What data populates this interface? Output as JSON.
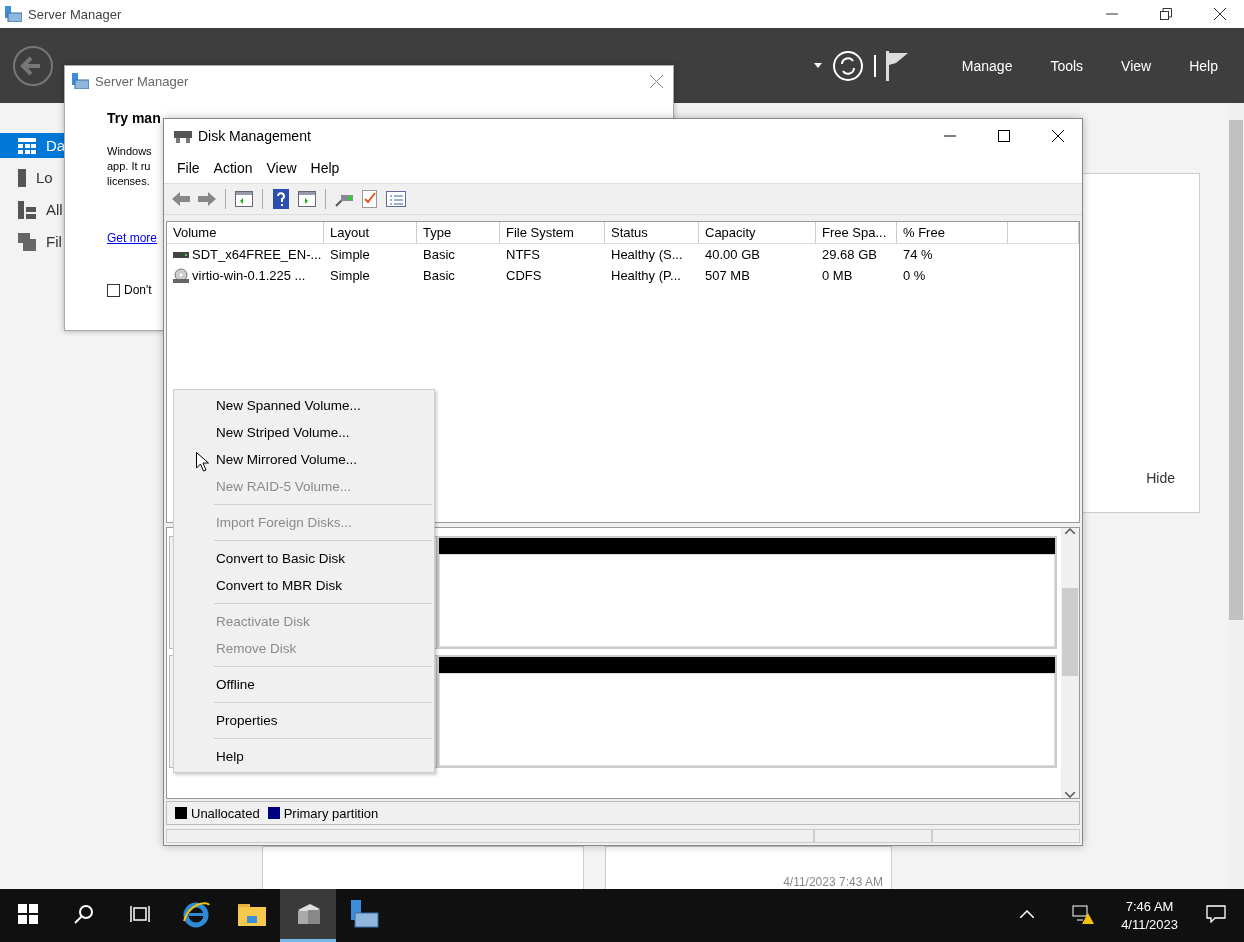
{
  "main_window": {
    "title": "Server Manager",
    "header_menu": [
      "Manage",
      "Tools",
      "View",
      "Help"
    ],
    "sidebar": [
      {
        "label": "Da",
        "kind": "dashboard",
        "selected": true
      },
      {
        "label": "Lo",
        "kind": "server",
        "selected": false
      },
      {
        "label": "All",
        "kind": "servers",
        "selected": false
      },
      {
        "label": "Fil",
        "kind": "files",
        "selected": false
      }
    ],
    "panel": {
      "hide": "Hide"
    },
    "tile_timestamp": "4/11/2023 7:43 AM"
  },
  "dialog": {
    "title": "Server Manager",
    "heading": "Try man",
    "body_lines": [
      "Windows",
      "app. It ru",
      "licenses."
    ],
    "link": "Get more",
    "checkbox": {
      "label": "Don't",
      "checked": false
    }
  },
  "disk_management": {
    "title": "Disk Management",
    "menu": [
      "File",
      "Action",
      "View",
      "Help"
    ],
    "columns": [
      "Volume",
      "Layout",
      "Type",
      "File System",
      "Status",
      "Capacity",
      "Free Spa...",
      "% Free"
    ],
    "rows": [
      {
        "kind": "disk",
        "cells": [
          "SDT_x64FREE_EN-...",
          "Simple",
          "Basic",
          "NTFS",
          "Healthy (S...",
          "40.00 GB",
          "29.68 GB",
          "74 %"
        ]
      },
      {
        "kind": "cd",
        "cells": [
          "virtio-win-0.1.225 ...",
          "Simple",
          "Basic",
          "CDFS",
          "Healthy (P...",
          "507 MB",
          "0 MB",
          "0 %"
        ]
      }
    ],
    "disks": [
      {
        "kind": "unallocated"
      },
      {
        "kind": "unallocated"
      }
    ],
    "legend": [
      {
        "label": "Unallocated",
        "color": "#000000"
      },
      {
        "label": "Primary partition",
        "color": "#000080"
      }
    ],
    "context_menu": [
      {
        "kind": "item",
        "label": "New Spanned Volume...",
        "disabled": false
      },
      {
        "kind": "item",
        "label": "New Striped Volume...",
        "disabled": false
      },
      {
        "kind": "item",
        "label": "New Mirrored Volume...",
        "disabled": false
      },
      {
        "kind": "item",
        "label": "New RAID-5 Volume...",
        "disabled": true
      },
      {
        "kind": "separator"
      },
      {
        "kind": "item",
        "label": "Import Foreign Disks...",
        "disabled": true
      },
      {
        "kind": "separator"
      },
      {
        "kind": "item",
        "label": "Convert to Basic Disk",
        "disabled": false
      },
      {
        "kind": "item",
        "label": "Convert to MBR Disk",
        "disabled": false
      },
      {
        "kind": "separator"
      },
      {
        "kind": "item",
        "label": "Reactivate Disk",
        "disabled": true
      },
      {
        "kind": "item",
        "label": "Remove Disk",
        "disabled": true
      },
      {
        "kind": "separator"
      },
      {
        "kind": "item",
        "label": "Offline",
        "disabled": false
      },
      {
        "kind": "separator"
      },
      {
        "kind": "item",
        "label": "Properties",
        "disabled": false
      },
      {
        "kind": "separator"
      },
      {
        "kind": "item",
        "label": "Help",
        "disabled": false
      }
    ]
  },
  "taskbar": {
    "apps": [
      {
        "kind": "browser",
        "selected": false
      },
      {
        "kind": "folder",
        "selected": false
      },
      {
        "kind": "disk",
        "selected": true
      },
      {
        "kind": "server",
        "selected": false
      }
    ],
    "time": "7:46 AM",
    "date": "4/11/2023"
  }
}
